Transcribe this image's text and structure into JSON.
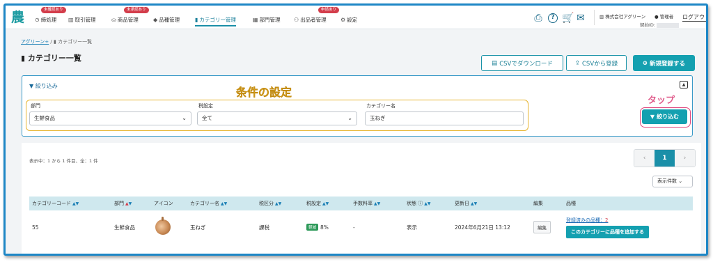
{
  "nav": {
    "logo": "農",
    "items": [
      {
        "icon": "⊙",
        "label": "締処理",
        "badge": "未確認あり"
      },
      {
        "icon": "▥",
        "label": "取引管理",
        "badge": ""
      },
      {
        "icon": "⛀",
        "label": "商品管理",
        "badge": "未承認あり"
      },
      {
        "icon": "◆",
        "label": "品種管理",
        "badge": ""
      },
      {
        "icon": "▮",
        "label": "カテゴリー管理",
        "badge": ""
      },
      {
        "icon": "▦",
        "label": "部門管理",
        "badge": ""
      },
      {
        "icon": "⚇",
        "label": "出品者管理",
        "badge": "申請あり"
      },
      {
        "icon": "⚙",
        "label": "設定",
        "badge": ""
      }
    ],
    "company": "株式会社アグリーン",
    "user_role": "管理者",
    "contract_label": "契約ID:",
    "logout": "ログアウト"
  },
  "breadcrumb": {
    "root": "アグリーン+",
    "sep": "/",
    "current": "カテゴリー一覧"
  },
  "page_title": "カテゴリー一覧",
  "actions": {
    "csv_download": "CSVでダウンロード",
    "csv_register": "CSVから登録",
    "new_register": "新規登録する"
  },
  "filter": {
    "title": "絞り込み",
    "annotation_conditions": "条件の設定",
    "annotation_tap": "タップ",
    "fields": [
      {
        "label": "部門",
        "value": "生鮮食品"
      },
      {
        "label": "税設定",
        "value": "全て"
      },
      {
        "label": "カテゴリー名",
        "value": "玉ねぎ"
      }
    ],
    "submit": "絞り込む"
  },
  "results": {
    "count_text": "表示中：1 から 1 件目、全：1 件",
    "pager": {
      "prev": "‹",
      "current": "1",
      "next": "›"
    },
    "per_page": "表示件数",
    "columns": [
      "カテゴリーコード",
      "部門",
      "アイコン",
      "カテゴリー名",
      "税区分",
      "税設定",
      "手数料率",
      "状態",
      "更新日",
      "編集",
      "品種"
    ],
    "rows": [
      {
        "code": "55",
        "department": "生鮮食品",
        "name": "玉ねぎ",
        "tax_category": "課税",
        "tax_badge": "軽減",
        "tax_rate": "8%",
        "fee_rate": "-",
        "status": "表示",
        "updated": "2024年6月21日 13:12",
        "edit": "編集",
        "registered_link": "登録済みの品種：",
        "registered_count": "2",
        "add_button": "このカテゴリーに品種を追加する"
      }
    ]
  }
}
